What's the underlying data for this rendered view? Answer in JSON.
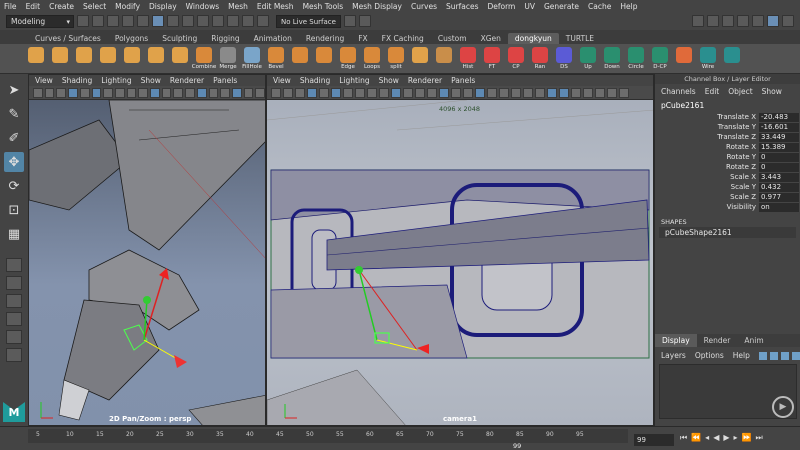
{
  "menubar": [
    "File",
    "Edit",
    "Create",
    "Select",
    "Modify",
    "Display",
    "Windows",
    "Mesh",
    "Edit Mesh",
    "Mesh Tools",
    "Mesh Display",
    "Curves",
    "Surfaces",
    "Deform",
    "UV",
    "Generate",
    "Cache",
    "Help"
  ],
  "status": {
    "mode": "Modeling",
    "live_surface": "No Live Surface"
  },
  "shelf_tabs": [
    "Curves / Surfaces",
    "Polygons",
    "Sculpting",
    "Rigging",
    "Animation",
    "Rendering",
    "FX",
    "FX Caching",
    "Custom",
    "XGen",
    "dongkyun",
    "TURTLE"
  ],
  "shelf_active": "dongkyun",
  "shelf_buttons": [
    {
      "label": "",
      "color": "#e0a24a"
    },
    {
      "label": "",
      "color": "#e0a24a"
    },
    {
      "label": "",
      "color": "#e0a24a"
    },
    {
      "label": "",
      "color": "#e0a24a"
    },
    {
      "label": "",
      "color": "#e0a24a"
    },
    {
      "label": "",
      "color": "#e0a24a"
    },
    {
      "label": "",
      "color": "#e0a24a"
    },
    {
      "label": "Combine",
      "color": "#d9893a"
    },
    {
      "label": "Merge",
      "color": "#8a8a8a"
    },
    {
      "label": "FillHole",
      "color": "#7aa5c9"
    },
    {
      "label": "Bevel",
      "color": "#d9893a"
    },
    {
      "label": "",
      "color": "#d9893a"
    },
    {
      "label": "",
      "color": "#d9893a"
    },
    {
      "label": "Edge",
      "color": "#d9893a"
    },
    {
      "label": "Loops",
      "color": "#d9893a"
    },
    {
      "label": "split",
      "color": "#d9893a"
    },
    {
      "label": "",
      "color": "#e0a24a"
    },
    {
      "label": "",
      "color": "#c98e4a"
    },
    {
      "label": "Hist",
      "color": "#d44"
    },
    {
      "label": "FT",
      "color": "#d44"
    },
    {
      "label": "CP",
      "color": "#d44"
    },
    {
      "label": "Ran",
      "color": "#d44"
    },
    {
      "label": "DS",
      "color": "#5b5bd6"
    },
    {
      "label": "Up",
      "color": "#2a8f6f"
    },
    {
      "label": "Down",
      "color": "#2a8f6f"
    },
    {
      "label": "Circle",
      "color": "#2a8f6f"
    },
    {
      "label": "D-CP",
      "color": "#2a8f6f"
    },
    {
      "label": "",
      "color": "#e06a3a"
    },
    {
      "label": "Wire",
      "color": "#2a8f8f"
    },
    {
      "label": "",
      "color": "#2a8f8f"
    }
  ],
  "viewport_menu": [
    "View",
    "Shading",
    "Lighting",
    "Show",
    "Renderer",
    "Panels"
  ],
  "left_viewport": {
    "label": "2D Pan/Zoom : persp"
  },
  "mid_viewport": {
    "label": "camera1",
    "resolution": "4096 x 2048"
  },
  "channel_box": {
    "title": "Channel Box / Layer Editor",
    "menu": [
      "Channels",
      "Edit",
      "Object",
      "Show"
    ],
    "object": "pCube2161",
    "attributes": [
      {
        "name": "Translate X",
        "value": "-20.483"
      },
      {
        "name": "Translate Y",
        "value": "-16.601"
      },
      {
        "name": "Translate Z",
        "value": "33.449"
      },
      {
        "name": "Rotate X",
        "value": "15.389"
      },
      {
        "name": "Rotate Y",
        "value": "0"
      },
      {
        "name": "Rotate Z",
        "value": "0"
      },
      {
        "name": "Scale X",
        "value": "3.443"
      },
      {
        "name": "Scale Y",
        "value": "0.432"
      },
      {
        "name": "Scale Z",
        "value": "0.977"
      },
      {
        "name": "Visibility",
        "value": "on"
      }
    ],
    "shapes_header": "SHAPES",
    "shape": "pCubeShape2161"
  },
  "layer_editor": {
    "tabs": [
      "Display",
      "Render",
      "Anim"
    ],
    "active": "Display",
    "menu": [
      "Layers",
      "Options",
      "Help"
    ]
  },
  "timeline": {
    "ticks": [
      "5",
      "10",
      "15",
      "20",
      "25",
      "30",
      "35",
      "40",
      "45",
      "50",
      "55",
      "60",
      "65",
      "70",
      "75",
      "80",
      "85",
      "90",
      "95"
    ],
    "current": "99",
    "frame_field": "99"
  }
}
